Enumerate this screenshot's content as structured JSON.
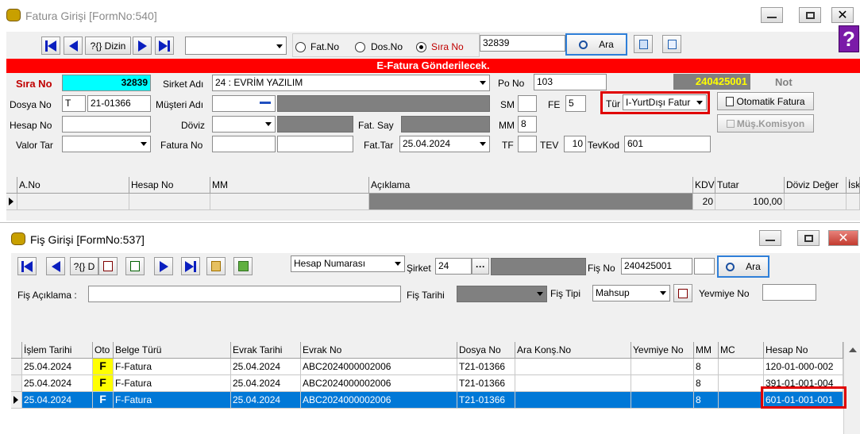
{
  "window1": {
    "title": "Fatura Girişi [FormNo:540]",
    "toolbar": {
      "dizin_label": "?{} Dizin",
      "combo_value": "",
      "radios": [
        {
          "label": "Fat.No",
          "selected": false
        },
        {
          "label": "Dos.No",
          "selected": false
        },
        {
          "label": "Sıra No",
          "selected": true
        }
      ],
      "search_value": "32839",
      "ara_label": "Ara"
    },
    "banner": "E-Fatura Gönderilecek.",
    "form": {
      "sira_no_label": "Sıra No",
      "sira_no_value": "32839",
      "sirket_adi_label": "Sirket Adı",
      "sirket_adi_value": "24 : EVRİM YAZILIM",
      "po_no_label": "Po No",
      "po_no_value": "103",
      "fis_no_value": "240425001",
      "not_label": "Not",
      "dosya_no_label": "Dosya No",
      "dosya_prefix": "T",
      "dosya_no_value": "21-01366",
      "musteri_adi_label": "Müşteri Adı",
      "sm_label": "SM",
      "fe_label": "FE",
      "fe_value": "5",
      "tur_label": "Tür",
      "tur_value": "I-YurtDışı Fatur",
      "otomatik_fatura_label": "Otomatik Fatura",
      "mus_komisyon_label": "Müş.Komisyon",
      "hesap_no_label": "Hesap No",
      "doviz_label": "Döviz",
      "fat_say_label": "Fat. Say",
      "mm_label": "MM",
      "mm_value": "8",
      "valor_tar_label": "Valor Tar",
      "fatura_no_label": "Fatura No",
      "fat_tar_label": "Fat.Tar",
      "fat_tar_value": "25.04.2024",
      "tf_label": "TF",
      "tev_label": "TEV",
      "tev_value": "10",
      "tevkod_label": "TevKod",
      "tevkod_value": "601"
    },
    "grid": {
      "headers": [
        "A.No",
        "Hesap No",
        "MM",
        "Açıklama",
        "KDV",
        "Tutar",
        "Döviz Değer",
        "İsk"
      ],
      "row": {
        "kdv": "20",
        "tutar": "100,00"
      }
    }
  },
  "window2": {
    "title": "Fiş Girişi [FormNo:537]",
    "toolbar": {
      "dizin_label": "?{} D",
      "hesap_combo": "Hesap Numarası",
      "sirket_label": "Şirket",
      "sirket_value": "24",
      "fis_no_label": "Fiş No",
      "fis_no_value": "240425001",
      "ara_label": "Ara"
    },
    "form": {
      "fis_aciklama_label": "Fiş Açıklama :",
      "fis_tarihi_label": "Fiş Tarihi",
      "fis_tipi_label": "Fiş  Tipi",
      "fis_tipi_value": "Mahsup",
      "yevmiye_no_label": "Yevmiye No"
    },
    "grid": {
      "headers": [
        "İşlem Tarihi",
        "Oto",
        "Belge Türü",
        "Evrak Tarihi",
        "Evrak No",
        "Dosya No",
        "Ara Konş.No",
        "Yevmiye No",
        "MM",
        "MC",
        "Hesap No"
      ],
      "rows": [
        {
          "tarih": "25.04.2024",
          "oto": "F",
          "belge": "F-Fatura",
          "evrak_tarih": "25.04.2024",
          "evrak_no": "ABC2024000002006",
          "dosya": "T21-01366",
          "ara": "",
          "yevmiye": "",
          "mm": "8",
          "mc": "",
          "hesap": "120-01-000-002",
          "selected": false
        },
        {
          "tarih": "25.04.2024",
          "oto": "F",
          "belge": "F-Fatura",
          "evrak_tarih": "25.04.2024",
          "evrak_no": "ABC2024000002006",
          "dosya": "T21-01366",
          "ara": "",
          "yevmiye": "",
          "mm": "8",
          "mc": "",
          "hesap": "391-01-001-004",
          "selected": false
        },
        {
          "tarih": "25.04.2024",
          "oto": "F",
          "belge": "F-Fatura",
          "evrak_tarih": "25.04.2024",
          "evrak_no": "ABC2024000002006",
          "dosya": "T21-01366",
          "ara": "",
          "yevmiye": "",
          "mm": "8",
          "mc": "",
          "hesap": "601-01-001-001",
          "selected": true
        }
      ]
    }
  },
  "colors": {
    "banner_red": "#ff0000",
    "cyan": "#00ffff",
    "selected_row": "#0078d7",
    "highlight": "#e00000",
    "oto_yellow": "#ffff00",
    "fisno_gold": "#ffff00"
  }
}
